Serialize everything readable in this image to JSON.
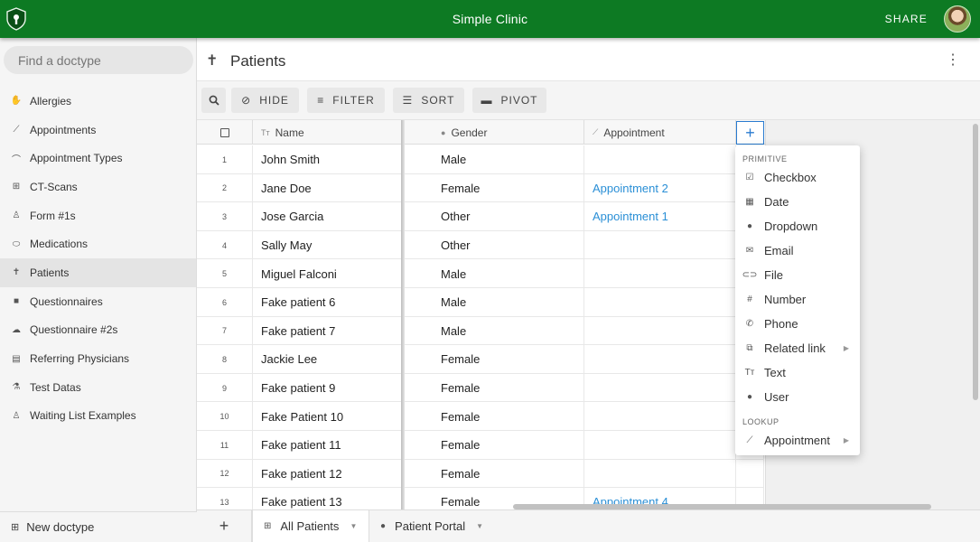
{
  "app": {
    "title": "Simple Clinic",
    "share_label": "SHARE"
  },
  "sidebar": {
    "search_placeholder": "Find a doctype",
    "items": [
      {
        "label": "Allergies",
        "icon": "hand-icon"
      },
      {
        "label": "Appointments",
        "icon": "syringe-icon"
      },
      {
        "label": "Appointment Types",
        "icon": "stethoscope-icon"
      },
      {
        "label": "CT-Scans",
        "icon": "hospital-icon"
      },
      {
        "label": "Form #1s",
        "icon": "person-icon"
      },
      {
        "label": "Medications",
        "icon": "pill-icon"
      },
      {
        "label": "Patients",
        "icon": "person-icon",
        "active": true
      },
      {
        "label": "Questionnaires",
        "icon": "box-icon"
      },
      {
        "label": "Questionnaire #2s",
        "icon": "cloud-icon"
      },
      {
        "label": "Referring Physicians",
        "icon": "file-icon"
      },
      {
        "label": "Test Datas",
        "icon": "flask-icon"
      },
      {
        "label": "Waiting List Examples",
        "icon": "person-icon"
      }
    ],
    "new_doctype_label": "New doctype"
  },
  "page": {
    "title": "Patients"
  },
  "toolbar": {
    "hide": "HIDE",
    "filter": "FILTER",
    "sort": "SORT",
    "pivot": "PIVOT"
  },
  "grid": {
    "columns": {
      "name": "Name",
      "gender": "Gender",
      "appointment": "Appointment"
    },
    "rows": [
      {
        "num": "1",
        "name": "John Smith",
        "gender": "Male",
        "appointment": ""
      },
      {
        "num": "2",
        "name": "Jane Doe",
        "gender": "Female",
        "appointment": "Appointment 2"
      },
      {
        "num": "3",
        "name": "Jose Garcia",
        "gender": "Other",
        "appointment": "Appointment 1"
      },
      {
        "num": "4",
        "name": "Sally May",
        "gender": "Other",
        "appointment": ""
      },
      {
        "num": "5",
        "name": "Miguel Falconi",
        "gender": "Male",
        "appointment": ""
      },
      {
        "num": "6",
        "name": "Fake patient 6",
        "gender": "Male",
        "appointment": ""
      },
      {
        "num": "7",
        "name": "Fake patient 7",
        "gender": "Male",
        "appointment": ""
      },
      {
        "num": "8",
        "name": "Jackie Lee",
        "gender": "Female",
        "appointment": ""
      },
      {
        "num": "9",
        "name": "Fake patient 9",
        "gender": "Female",
        "appointment": ""
      },
      {
        "num": "10",
        "name": "Fake Patient 10",
        "gender": "Female",
        "appointment": ""
      },
      {
        "num": "11",
        "name": "Fake patient 11",
        "gender": "Female",
        "appointment": ""
      },
      {
        "num": "12",
        "name": "Fake patient 12",
        "gender": "Female",
        "appointment": ""
      },
      {
        "num": "13",
        "name": "Fake patient 13",
        "gender": "Female",
        "appointment": "Appointment 4"
      }
    ]
  },
  "add_column_menu": {
    "primitive_label": "PRIMITIVE",
    "primitive_items": [
      {
        "label": "Checkbox",
        "icon": "checkbox-icon"
      },
      {
        "label": "Date",
        "icon": "calendar-icon"
      },
      {
        "label": "Dropdown",
        "icon": "dropdown-icon"
      },
      {
        "label": "Email",
        "icon": "email-icon"
      },
      {
        "label": "File",
        "icon": "attachment-icon"
      },
      {
        "label": "Number",
        "icon": "hash-icon"
      },
      {
        "label": "Phone",
        "icon": "phone-icon"
      },
      {
        "label": "Related link",
        "icon": "link-icon",
        "submenu": true
      },
      {
        "label": "Text",
        "icon": "text-icon"
      },
      {
        "label": "User",
        "icon": "user-icon"
      }
    ],
    "lookup_label": "LOOKUP",
    "lookup_items": [
      {
        "label": "Appointment",
        "icon": "syringe-icon",
        "submenu": true
      }
    ]
  },
  "views": {
    "tabs": [
      {
        "label": "All Patients",
        "icon": "grid-icon",
        "active": true
      },
      {
        "label": "Patient Portal",
        "icon": "portal-icon"
      }
    ]
  },
  "colors": {
    "brand": "#0d7a23",
    "link": "#2a8fd6",
    "accent": "#2a7bd0"
  }
}
